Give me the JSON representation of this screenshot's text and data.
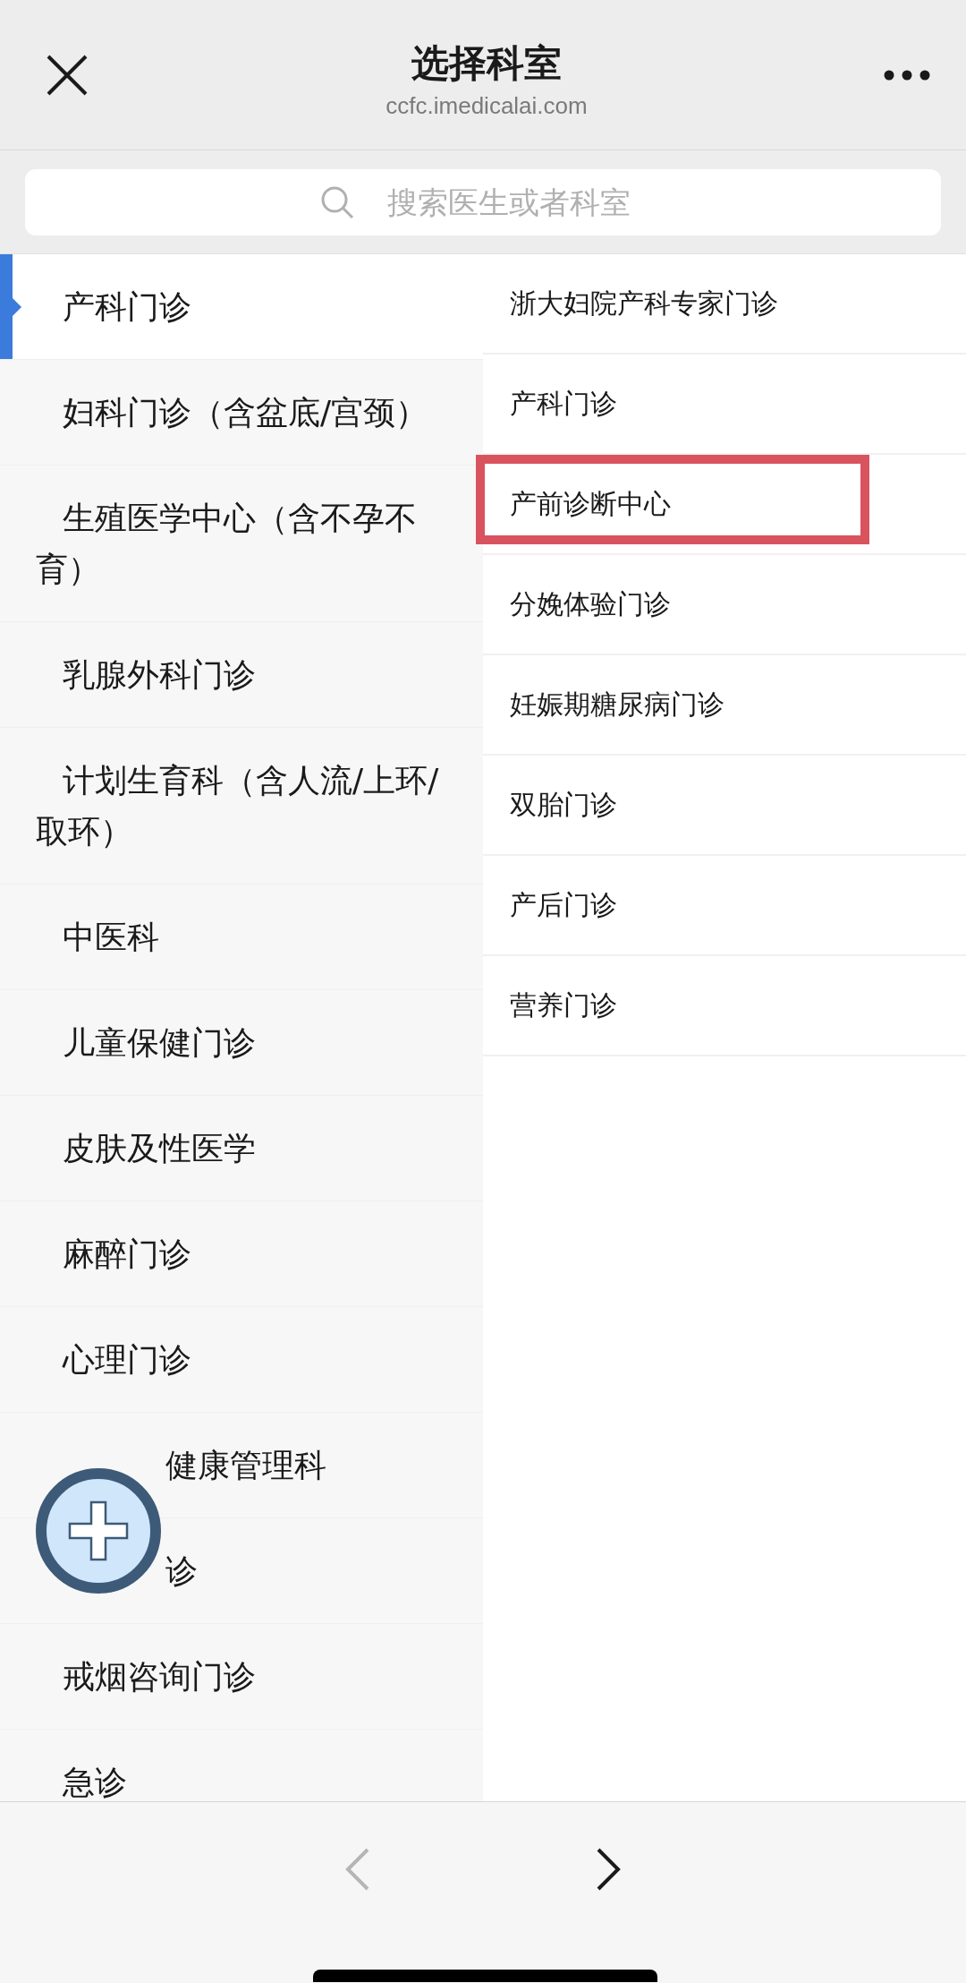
{
  "header": {
    "title": "选择科室",
    "url": "ccfc.imedicalai.com"
  },
  "search": {
    "placeholder": "搜索医生或者科室"
  },
  "departments": [
    {
      "label": "产科门诊",
      "selected": true
    },
    {
      "label": "妇科门诊（含盆底/宫颈）",
      "selected": false
    },
    {
      "label": "生殖医学中心（含不孕不育）",
      "selected": false
    },
    {
      "label": "乳腺外科门诊",
      "selected": false
    },
    {
      "label": "计划生育科（含人流/上环/取环）",
      "selected": false
    },
    {
      "label": "中医科",
      "selected": false
    },
    {
      "label": "儿童保健门诊",
      "selected": false
    },
    {
      "label": "皮肤及性医学",
      "selected": false
    },
    {
      "label": "麻醉门诊",
      "selected": false
    },
    {
      "label": "心理门诊",
      "selected": false
    },
    {
      "label": "健康管理科",
      "selected": false,
      "kind": "overlapped"
    },
    {
      "label": "诊",
      "selected": false,
      "kind": "overlapped"
    },
    {
      "label": "戒烟咨询门诊",
      "selected": false
    },
    {
      "label": "急诊",
      "selected": false
    }
  ],
  "sub_departments": [
    {
      "label": "浙大妇院产科专家门诊",
      "highlighted": false
    },
    {
      "label": "产科门诊",
      "highlighted": false
    },
    {
      "label": "产前诊断中心",
      "highlighted": true
    },
    {
      "label": "分娩体验门诊",
      "highlighted": false
    },
    {
      "label": "妊娠期糖尿病门诊",
      "highlighted": false
    },
    {
      "label": "双胎门诊",
      "highlighted": false
    },
    {
      "label": "产后门诊",
      "highlighted": false
    },
    {
      "label": "营养门诊",
      "highlighted": false
    }
  ],
  "nav": {
    "back_disabled": true,
    "forward_disabled": false
  }
}
